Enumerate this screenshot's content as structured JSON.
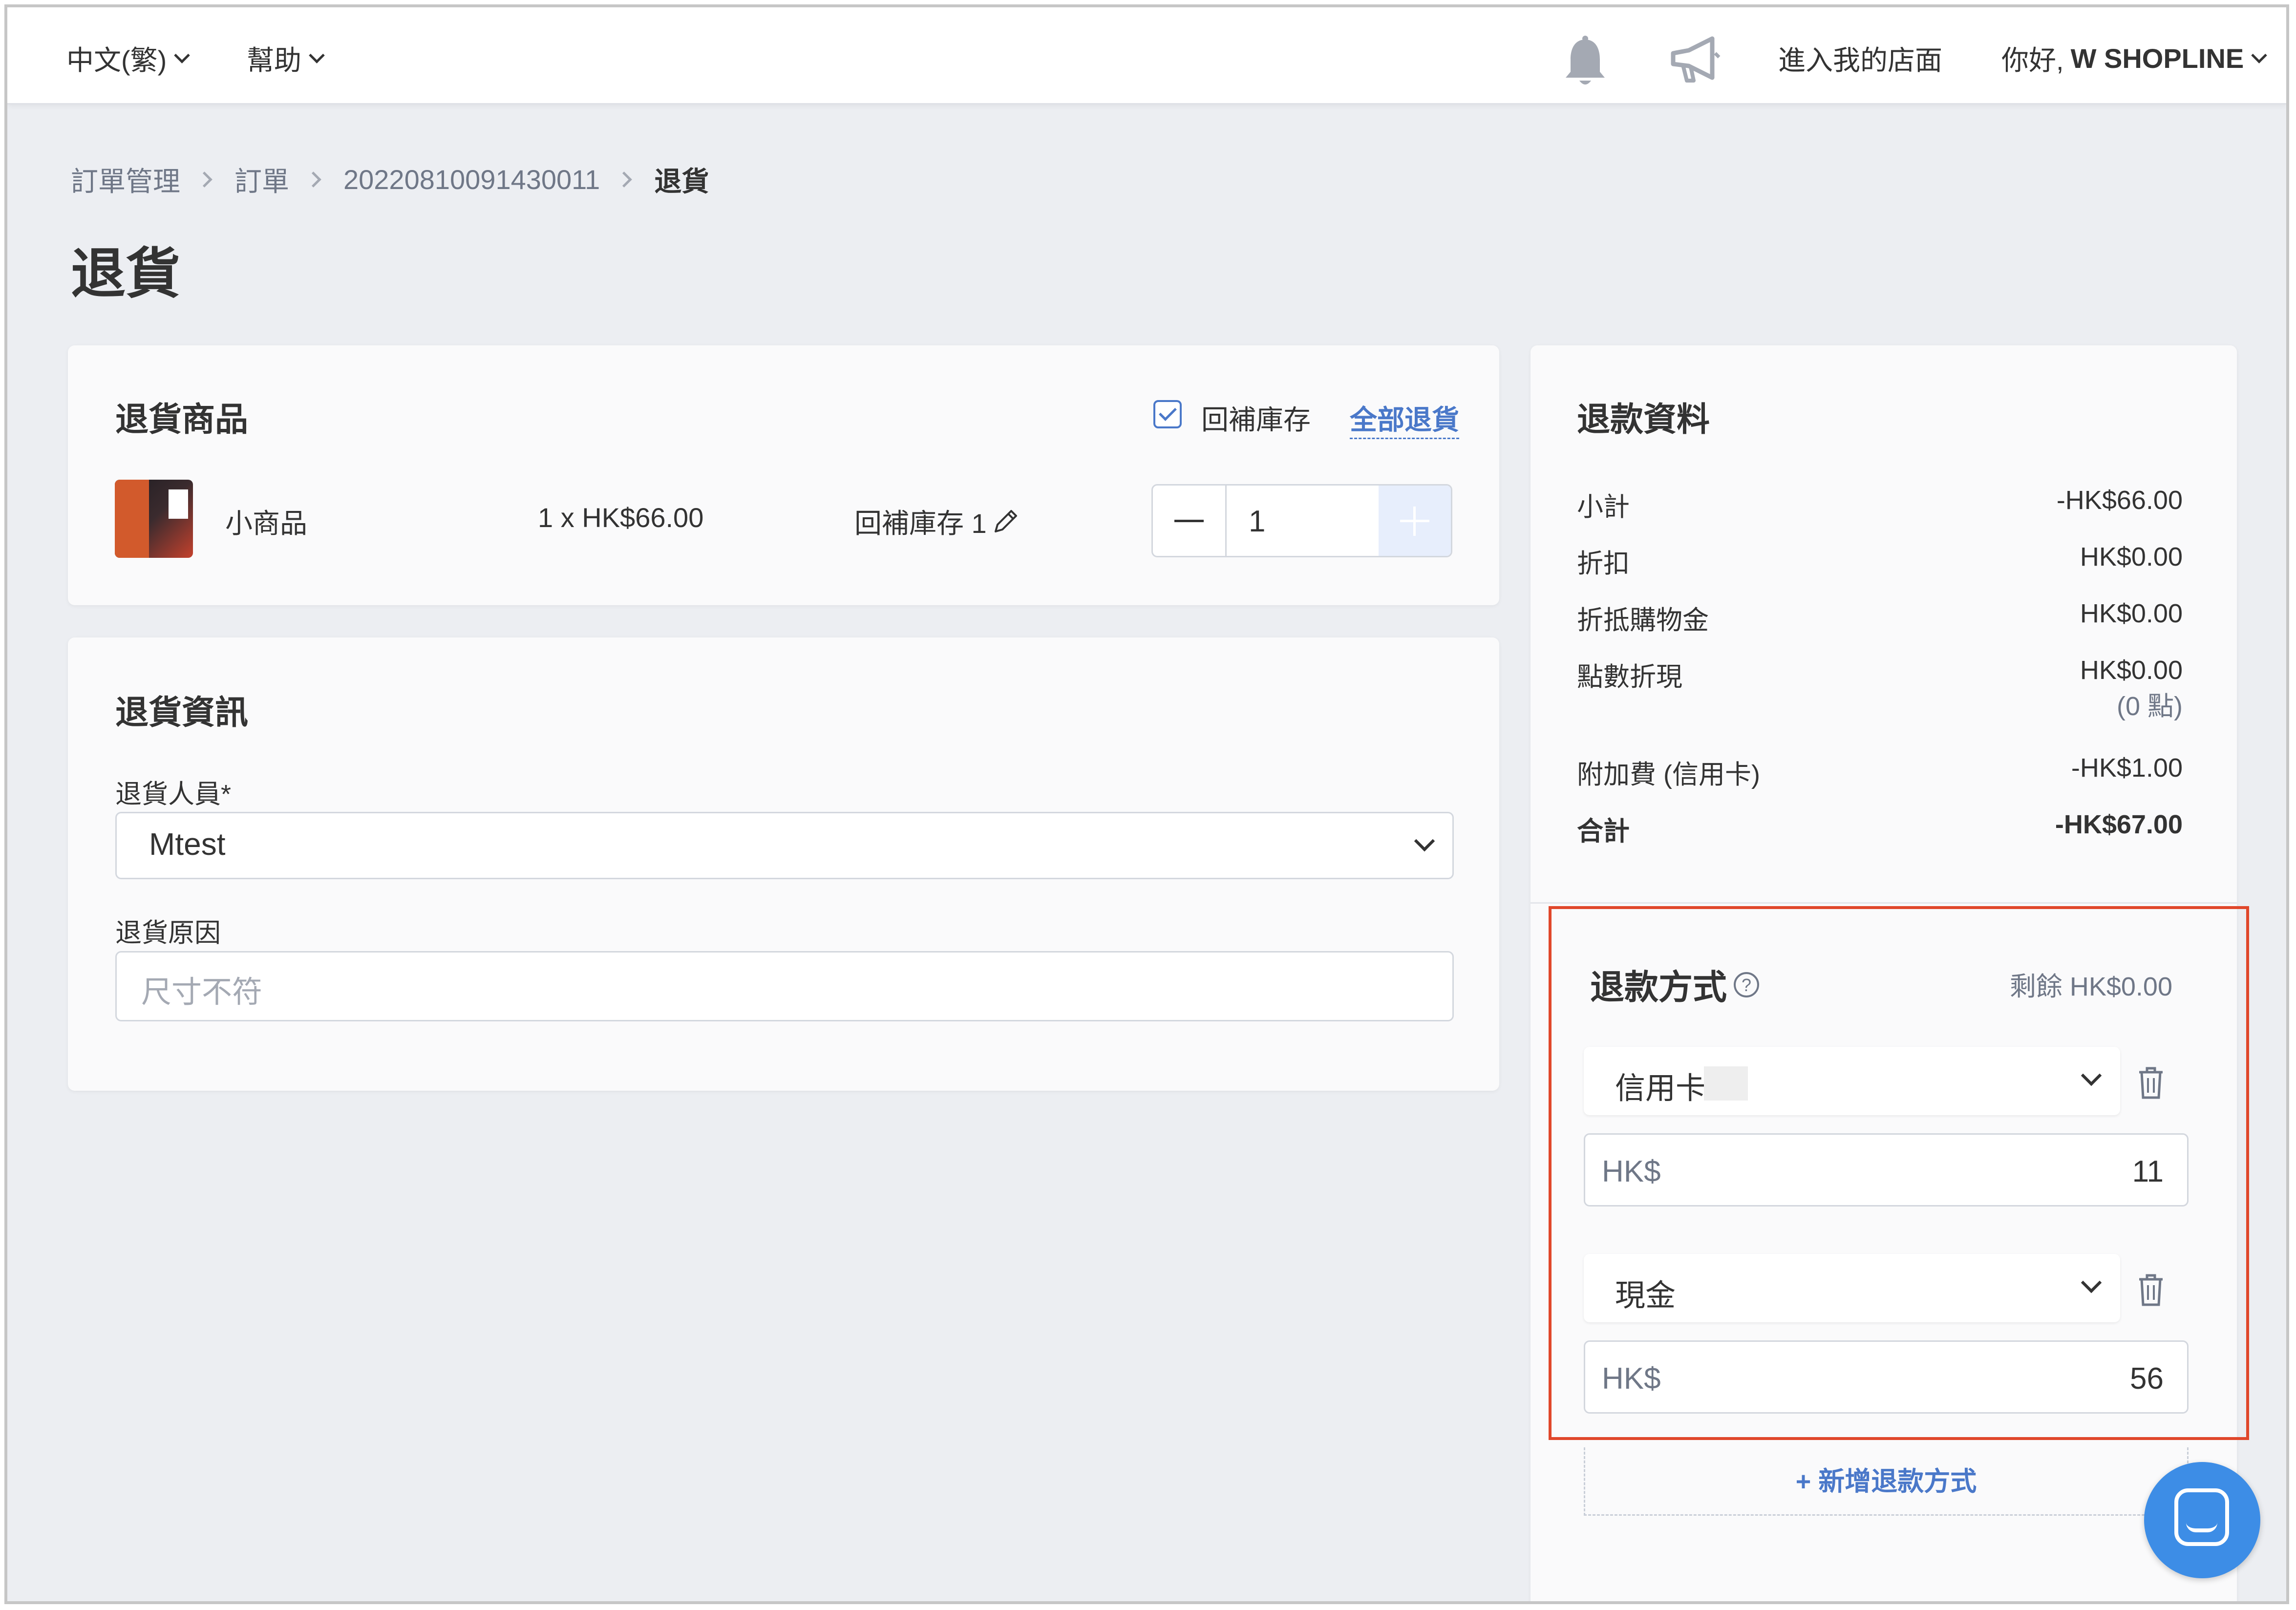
{
  "topbar": {
    "language": "中文(繁)",
    "help": "幫助",
    "store_link": "進入我的店面",
    "greeting": "你好,",
    "user": "W SHOPLINE"
  },
  "breadcrumb": {
    "items": [
      "訂單管理",
      "訂單",
      "20220810091430011"
    ],
    "current": "退貨"
  },
  "page": {
    "title": "退貨"
  },
  "return_items": {
    "title": "退貨商品",
    "restock_label": "回補庫存",
    "restock_checked": true,
    "return_all_link": "全部退貨",
    "item": {
      "name": "小商品",
      "price_line": "1 x HK$66.00",
      "restock_qty": "回補庫存 1",
      "quantity": "1"
    }
  },
  "return_info": {
    "title": "退貨資訊",
    "staff_label": "退貨人員*",
    "staff_value": "Mtest",
    "reason_label": "退貨原因",
    "reason_placeholder": "尺寸不符"
  },
  "refund_summary": {
    "title": "退款資料",
    "rows": [
      {
        "label": "小計",
        "amount": "-HK$66.00"
      },
      {
        "label": "折扣",
        "amount": "HK$0.00"
      },
      {
        "label": "折抵購物金",
        "amount": "HK$0.00"
      },
      {
        "label": "點數折現",
        "amount": "HK$0.00",
        "note": "(0 點)"
      },
      {
        "label": "附加費 (信用卡)",
        "amount": "-HK$1.00"
      },
      {
        "label": "合計",
        "amount": "-HK$67.00"
      }
    ]
  },
  "refund_methods": {
    "title": "退款方式",
    "help_icon": "?",
    "remaining": "剩餘 HK$0.00",
    "methods": [
      {
        "type": "信用卡",
        "currency": "HK$",
        "amount": "11"
      },
      {
        "type": "現金",
        "currency": "HK$",
        "amount": "56"
      }
    ],
    "add_label": "+ 新增退款方式"
  },
  "colors": {
    "accent": "#4a78c9",
    "highlight_border": "#e0472b",
    "chat_button": "#3d8de6"
  }
}
